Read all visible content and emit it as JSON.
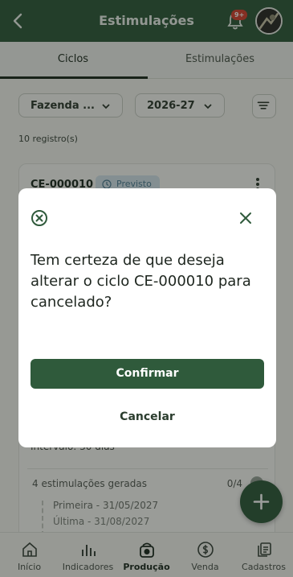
{
  "header": {
    "title": "Estimulações",
    "notification_badge": "9+"
  },
  "tabs": [
    {
      "label": "Ciclos"
    },
    {
      "label": "Estimulações"
    }
  ],
  "filters": {
    "farm": "Fazenda ...",
    "year": "2026-27"
  },
  "records_count": "10 registro(s)",
  "card": {
    "code": "CE-000010",
    "status": "Previsto",
    "interval": "Intervalo: 30 dias",
    "generated": "4 estimulações geradas",
    "generated_count": "0/4",
    "steps": [
      "Primeira - 31/05/2027",
      "Última - 31/08/2027"
    ]
  },
  "bottom_nav": [
    {
      "label": "Início",
      "icon": "home-icon"
    },
    {
      "label": "Indicadores",
      "icon": "bar-chart-icon"
    },
    {
      "label": "Produção",
      "icon": "production-icon"
    },
    {
      "label": "Venda",
      "icon": "dollar-icon"
    },
    {
      "label": "Cadastros",
      "icon": "documents-icon"
    }
  ],
  "modal": {
    "question": "Tem certeza de que deseja alterar o ciclo CE-000010 para cancelado?",
    "confirm_label": "Confirmar",
    "cancel_label": "Cancelar"
  },
  "colors": {
    "primary": "#2f5a3b",
    "status_bg": "#d6e6ee",
    "badge": "#d8412f"
  }
}
